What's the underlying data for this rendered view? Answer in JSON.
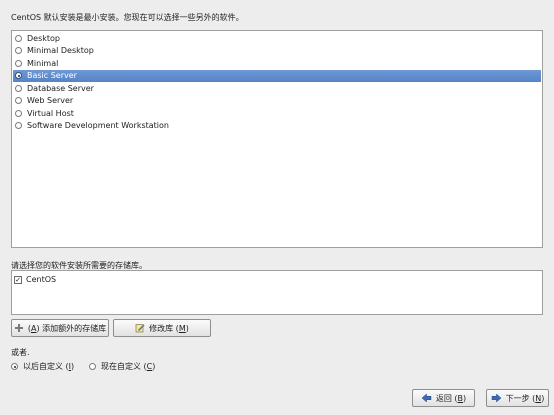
{
  "intro_text": "CentOS 默认安装是最小安装。您现在可以选择一些另外的软件。",
  "install_types": [
    {
      "label": "Desktop",
      "selected": false
    },
    {
      "label": "Minimal Desktop",
      "selected": false
    },
    {
      "label": "Minimal",
      "selected": false
    },
    {
      "label": "Basic Server",
      "selected": true
    },
    {
      "label": "Database Server",
      "selected": false
    },
    {
      "label": "Web Server",
      "selected": false
    },
    {
      "label": "Virtual Host",
      "selected": false
    },
    {
      "label": "Software Development Workstation",
      "selected": false
    }
  ],
  "repo_section": {
    "label": "请选择您的软件安装所需要的存储库。",
    "repos": [
      {
        "label": "CentOS",
        "checked": true
      }
    ],
    "add_button": {
      "prefix": "(",
      "mnemonic": "A",
      "suffix": ") 添加额外的存储库",
      "icon": "plus-icon"
    },
    "modify_button": {
      "label": "修改库 (",
      "mnemonic": "M",
      "suffix": ")",
      "icon": "edit-icon"
    }
  },
  "customize": {
    "label": "或者.",
    "later": {
      "label": "以后自定义 (",
      "mnemonic": "I",
      "suffix": ")",
      "selected": true
    },
    "now": {
      "label": "现在自定义 (",
      "mnemonic": "C",
      "suffix": ")",
      "selected": false
    }
  },
  "nav": {
    "back": {
      "label": "返回 (",
      "mnemonic": "B",
      "suffix": ")",
      "icon": "arrow-left-icon"
    },
    "next": {
      "label": "下一步 (",
      "mnemonic": "N",
      "suffix": ")",
      "icon": "arrow-right-icon"
    }
  },
  "colors": {
    "selection": "#5f8dd3",
    "background": "#ededed"
  }
}
